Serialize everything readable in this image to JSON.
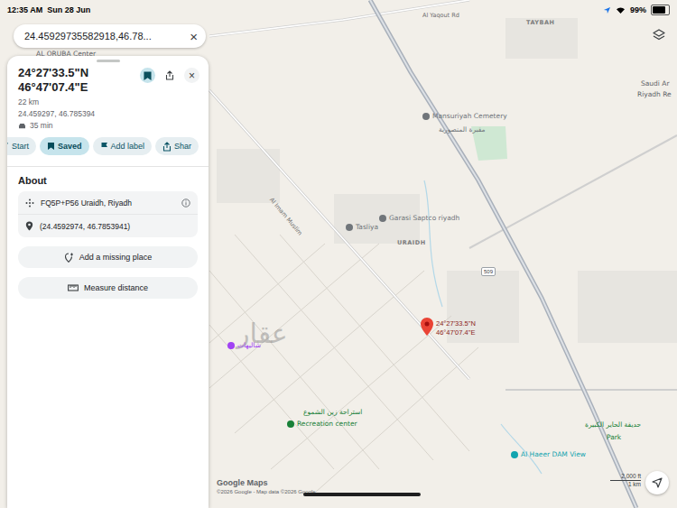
{
  "status_bar": {
    "time": "12:35 AM",
    "date": "Sun 28 Jun",
    "battery": "99%",
    "battery_level": 0.99
  },
  "search": {
    "value": "24.45929735582918,46.78...",
    "clear": "×"
  },
  "place": {
    "title_lines": [
      "24°27'33.5\"N",
      "46°47'07.4\"E"
    ],
    "saved": true,
    "close": "×",
    "distance": "22 km",
    "coords": "24.459297, 46.785394",
    "drive_time": "35 min"
  },
  "actions": [
    {
      "kind": "start",
      "label": "Start",
      "selected": false
    },
    {
      "kind": "saved",
      "label": "Saved",
      "selected": true
    },
    {
      "kind": "label",
      "label": "Add label",
      "selected": false
    },
    {
      "kind": "share",
      "label": "Shar",
      "selected": false
    }
  ],
  "about": {
    "heading": "About",
    "rows": [
      {
        "kind": "plus-code",
        "text": "FQ5P+P56 Uraidh, Riyadh",
        "info": true
      },
      {
        "kind": "coordinates",
        "text": "(24.4592974, 46.7853941)",
        "info": false
      }
    ]
  },
  "buttons": [
    {
      "kind": "add-place",
      "label": "Add a missing place"
    },
    {
      "kind": "measure",
      "label": "Measure distance"
    }
  ],
  "map": {
    "labels": [
      {
        "kind": "road",
        "text": "Al Yaqout Rd"
      },
      {
        "kind": "area",
        "text": "TAYBAH"
      },
      {
        "kind": "poi",
        "text": "Mansuriyah Cemetery",
        "color": "#70757a"
      },
      {
        "kind": "text",
        "text": "مقبرة المنصورية",
        "color": "#70757a"
      },
      {
        "kind": "poi",
        "text": "Garasi Saptco riyadh",
        "color": "#70757a"
      },
      {
        "kind": "poi",
        "text": "Tasliya",
        "color": "#70757a"
      },
      {
        "kind": "area",
        "text": "URAIDH"
      },
      {
        "kind": "road",
        "text": "Al Imam Muslim"
      },
      {
        "kind": "text",
        "text": "AL ORUBA Center",
        "color": "#5f6368"
      },
      {
        "kind": "text",
        "text": "Saudi Ar",
        "color": "#5f6368"
      },
      {
        "kind": "text",
        "text": "Riyadh Re",
        "color": "#5f6368"
      },
      {
        "kind": "text",
        "text": "استراحة زين الشموع",
        "color": "#188038"
      },
      {
        "kind": "poi",
        "text": "Recreation center",
        "color": "#188038"
      },
      {
        "kind": "poi",
        "text": "شاليهات",
        "color": "#a142f4"
      },
      {
        "kind": "poi",
        "text": "Al Haeer DAM View",
        "color": "#12a4af"
      },
      {
        "kind": "text",
        "text": "حديقة الحاير الكبيرة",
        "color": "#188038"
      },
      {
        "kind": "text",
        "text": "Park",
        "color": "#188038"
      }
    ],
    "pin": {
      "lines": [
        "24°27'33.5\"N",
        "46°47'07.4\"E"
      ]
    },
    "route_badge": "509",
    "scale": {
      "imperial": "2,000 ft",
      "metric": "1 km"
    },
    "brand": "Google Maps",
    "copyright": "©2026 Google - Map data ©2026 Google",
    "watermark": "عقار"
  }
}
